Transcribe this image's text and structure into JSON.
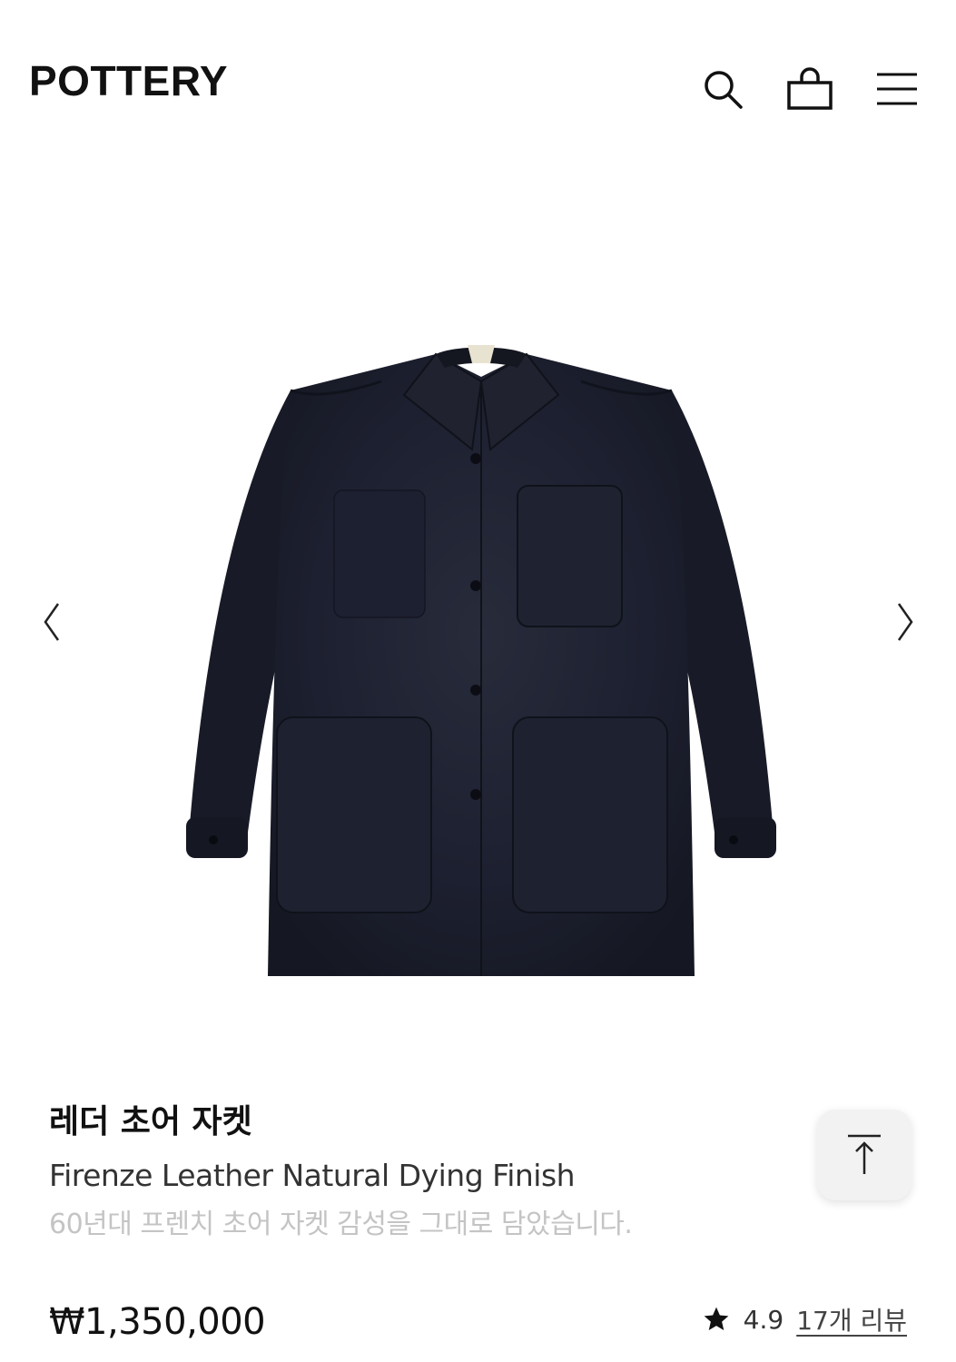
{
  "header": {
    "logo": "POTTERY",
    "icons": [
      "search-icon",
      "shopping-bag-icon",
      "menu-icon"
    ]
  },
  "gallery": {
    "image": "navy suede chore jacket",
    "prev_icon": "chevron-left-icon",
    "next_icon": "chevron-right-icon"
  },
  "product": {
    "title_ko": "레더 초어 자켓",
    "title_en": "Firenze Leather Natural Dying Finish",
    "description": "60년대 프렌치 초어 자켓 감성을 그대로 담았습니다.",
    "price": "₩1,350,000",
    "rating": "4.9",
    "reviews": "17개 리뷰"
  },
  "scroll_top": {
    "icon": "arrow-up-to-top-icon"
  },
  "colors": {
    "jacket": "#1c1f2b",
    "text": "#111111",
    "muted": "#c4c4c4",
    "button_bg": "#f2f2f2"
  }
}
